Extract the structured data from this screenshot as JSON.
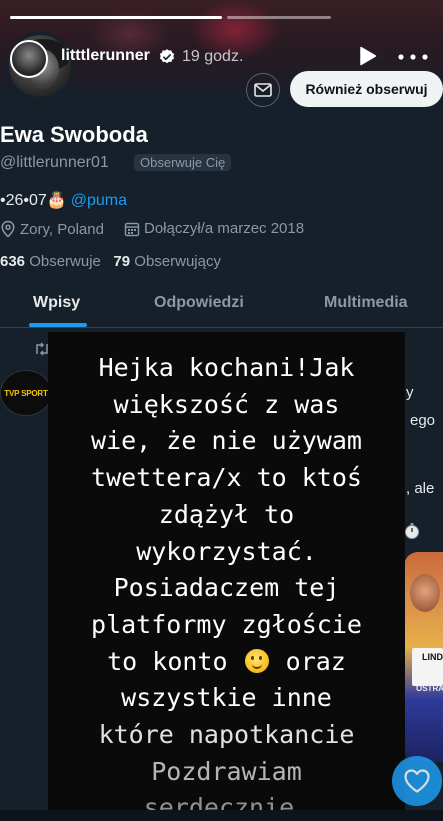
{
  "story": {
    "progress": [
      1.0,
      0.0
    ],
    "username": "litttlerunner",
    "time_ago": "19 godz.",
    "icons": {
      "verified": "verified-badge-icon",
      "play": "play-icon",
      "more": "more-horizontal-icon"
    }
  },
  "profile": {
    "display_name": "Ewa Swoboda",
    "handle": "@littlerunner01",
    "follows_you_badge": "Obserwuje Cię",
    "bio_date": "•26•07",
    "bio_mention": "@puma",
    "location": "Zory, Poland",
    "joined": "Dołączył/a marzec 2018",
    "following_count": "636",
    "following_label": "Obserwuje",
    "followers_count": "79",
    "followers_label": "Obserwujący",
    "follow_button": "Również obserwuj"
  },
  "tabs": [
    {
      "label": "Wpisy",
      "active": true
    },
    {
      "label": "Odpowiedzi",
      "active": false
    },
    {
      "label": "Multimedia",
      "active": false
    }
  ],
  "feed": {
    "source_logo": "TVP SPORT",
    "right_fragments": [
      "y",
      "ego",
      ", ale"
    ],
    "bib_text": "LIND",
    "bib_text2": "OSTRAVA"
  },
  "overlay": {
    "lines": [
      "Hejka kochani!Jak",
      "większość z was",
      "wie, że nie używam",
      "twettera/x to ktoś",
      "zdążył to",
      "wykorzystać.",
      "Posiadaczem tej",
      "platformy zgłoście",
      "to konto",
      "oraz",
      "wszystkie inne",
      "które napotkancie",
      "Pozdrawiam",
      "serdecznie."
    ]
  },
  "colors": {
    "accent": "#1d9bf0",
    "background": "#15202b",
    "overlay": "#0a0a0a"
  }
}
